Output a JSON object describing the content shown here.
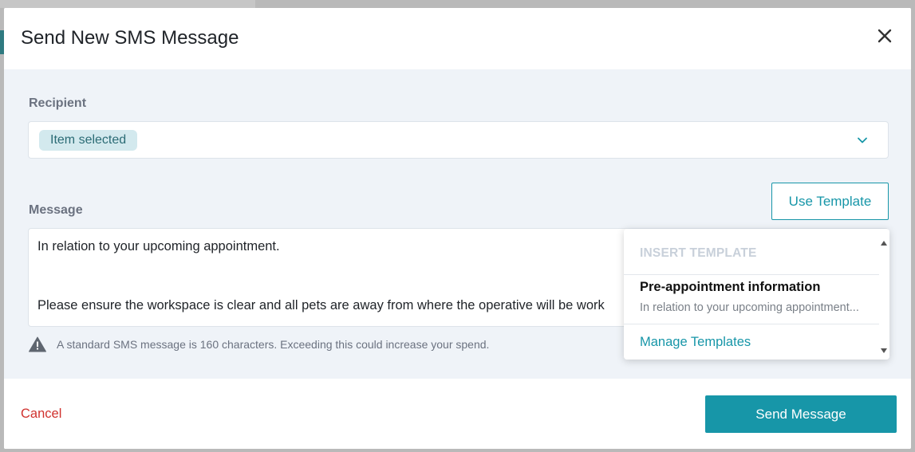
{
  "dialog": {
    "title": "Send New SMS Message",
    "close_icon": "close-icon"
  },
  "recipient": {
    "label": "Recipient",
    "selected_chip": "Item selected",
    "dropdown_icon": "chevron-down-icon"
  },
  "message": {
    "label": "Message",
    "use_template_label": "Use Template",
    "lines": [
      "In relation to your upcoming appointment.",
      "",
      "Please ensure the workspace is clear and all pets are away from where the operative will be work"
    ]
  },
  "warning": {
    "icon": "warning-icon",
    "text": "A standard SMS message is 160 characters. Exceeding this could increase your spend."
  },
  "template_dropdown": {
    "header": "INSERT TEMPLATE",
    "items": [
      {
        "title": "Pre-appointment information",
        "preview": "In relation to your upcoming appointment..."
      }
    ],
    "manage_label": "Manage Templates"
  },
  "footer": {
    "cancel_label": "Cancel",
    "send_label": "Send Message"
  },
  "colors": {
    "accent": "#1796a8",
    "cancel": "#d0312d",
    "body_bg": "#eff3f8",
    "chip_bg": "#d3e9ee"
  }
}
